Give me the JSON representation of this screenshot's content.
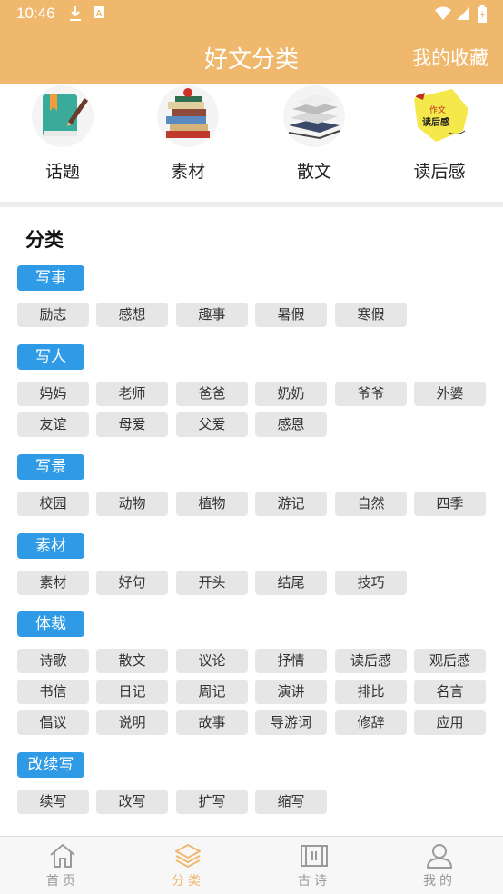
{
  "status_bar": {
    "time": "10:46"
  },
  "header": {
    "title": "好文分类",
    "favorites": "我的收藏"
  },
  "top_categories": [
    {
      "label": "话题"
    },
    {
      "label": "素材"
    },
    {
      "label": "散文"
    },
    {
      "label": "读后感",
      "art_text_1": "作文",
      "art_text_2": "读后感"
    }
  ],
  "section_title": "分类",
  "groups": [
    {
      "title": "写事",
      "items": [
        "励志",
        "感想",
        "趣事",
        "暑假",
        "寒假"
      ]
    },
    {
      "title": "写人",
      "items": [
        "妈妈",
        "老师",
        "爸爸",
        "奶奶",
        "爷爷",
        "外婆",
        "友谊",
        "母爱",
        "父爱",
        "感恩"
      ]
    },
    {
      "title": "写景",
      "items": [
        "校园",
        "动物",
        "植物",
        "游记",
        "自然",
        "四季"
      ]
    },
    {
      "title": "素材",
      "items": [
        "素材",
        "好句",
        "开头",
        "结尾",
        "技巧"
      ]
    },
    {
      "title": "体裁",
      "items": [
        "诗歌",
        "散文",
        "议论",
        "抒情",
        "读后感",
        "观后感",
        "书信",
        "日记",
        "周记",
        "演讲",
        "排比",
        "名言",
        "倡议",
        "说明",
        "故事",
        "导游词",
        "修辞",
        "应用"
      ]
    },
    {
      "title": "改续写",
      "items": [
        "续写",
        "改写",
        "扩写",
        "缩写"
      ]
    }
  ],
  "tabs": [
    {
      "label": "首页",
      "icon": "home-icon",
      "active": false
    },
    {
      "label": "分类",
      "icon": "layers-icon",
      "active": true
    },
    {
      "label": "古诗",
      "icon": "scroll-icon",
      "active": false
    },
    {
      "label": "我的",
      "icon": "user-icon",
      "active": false
    }
  ],
  "colors": {
    "accent": "#f0b86c",
    "tag_blue": "#2f9ae5",
    "chip_bg": "#e6e6e6"
  }
}
